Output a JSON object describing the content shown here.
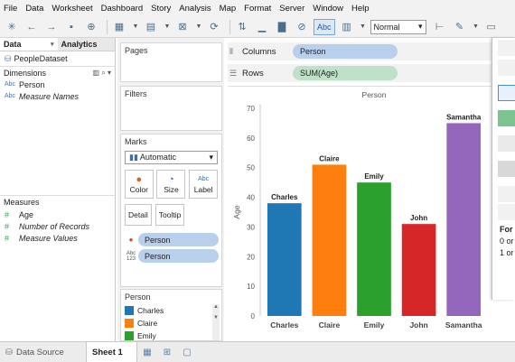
{
  "menu": [
    "File",
    "Data",
    "Worksheet",
    "Dashboard",
    "Story",
    "Analysis",
    "Map",
    "Format",
    "Server",
    "Window",
    "Help"
  ],
  "toolbar": {
    "abc_label": "Abc",
    "fit_value": "Normal"
  },
  "data_pane": {
    "tabs": [
      "Data",
      "Analytics"
    ],
    "datasource": "PeopleDataset",
    "dimensions_header": "Dimensions",
    "dimensions": [
      {
        "type": "Abc",
        "name": "Person"
      },
      {
        "type": "Abc",
        "name": "Measure Names"
      }
    ],
    "measures_header": "Measures",
    "measures": [
      {
        "type": "#",
        "name": "Age"
      },
      {
        "type": "#",
        "name": "Number of Records"
      },
      {
        "type": "#",
        "name": "Measure Values"
      }
    ]
  },
  "cards": {
    "pages_title": "Pages",
    "filters_title": "Filters",
    "marks_title": "Marks",
    "marks_type": "Automatic",
    "buttons": [
      "Color",
      "Size",
      "Label",
      "Detail",
      "Tooltip"
    ],
    "pills": [
      {
        "icon": "color-icon",
        "label": "Person"
      },
      {
        "icon": "label-icon",
        "label": "Person"
      }
    ],
    "legend_title": "Person",
    "legend_items": [
      "Charles",
      "Claire",
      "Emily"
    ]
  },
  "shelves": {
    "columns_label": "Columns",
    "columns_pill": "Person",
    "rows_label": "Rows",
    "rows_pill": "SUM(Age)"
  },
  "chart_data": {
    "type": "bar",
    "title": "Person",
    "ylabel": "Age",
    "xlabel": "",
    "categories": [
      "Charles",
      "Claire",
      "Emily",
      "John",
      "Samantha"
    ],
    "values": [
      38,
      51,
      45,
      31,
      65
    ],
    "colors": [
      "#1f77b4",
      "#ff7f0e",
      "#2ca02c",
      "#d62728",
      "#9467bd"
    ],
    "ylim": [
      0,
      70
    ],
    "yticks": [
      0,
      10,
      20,
      30,
      40,
      50,
      60,
      70
    ],
    "grid": false
  },
  "show_me": {
    "text_lines": [
      "For h",
      "0 or",
      "1 or"
    ]
  },
  "bottom_tabs": {
    "datasource": "Data Source",
    "sheet": "Sheet 1"
  }
}
